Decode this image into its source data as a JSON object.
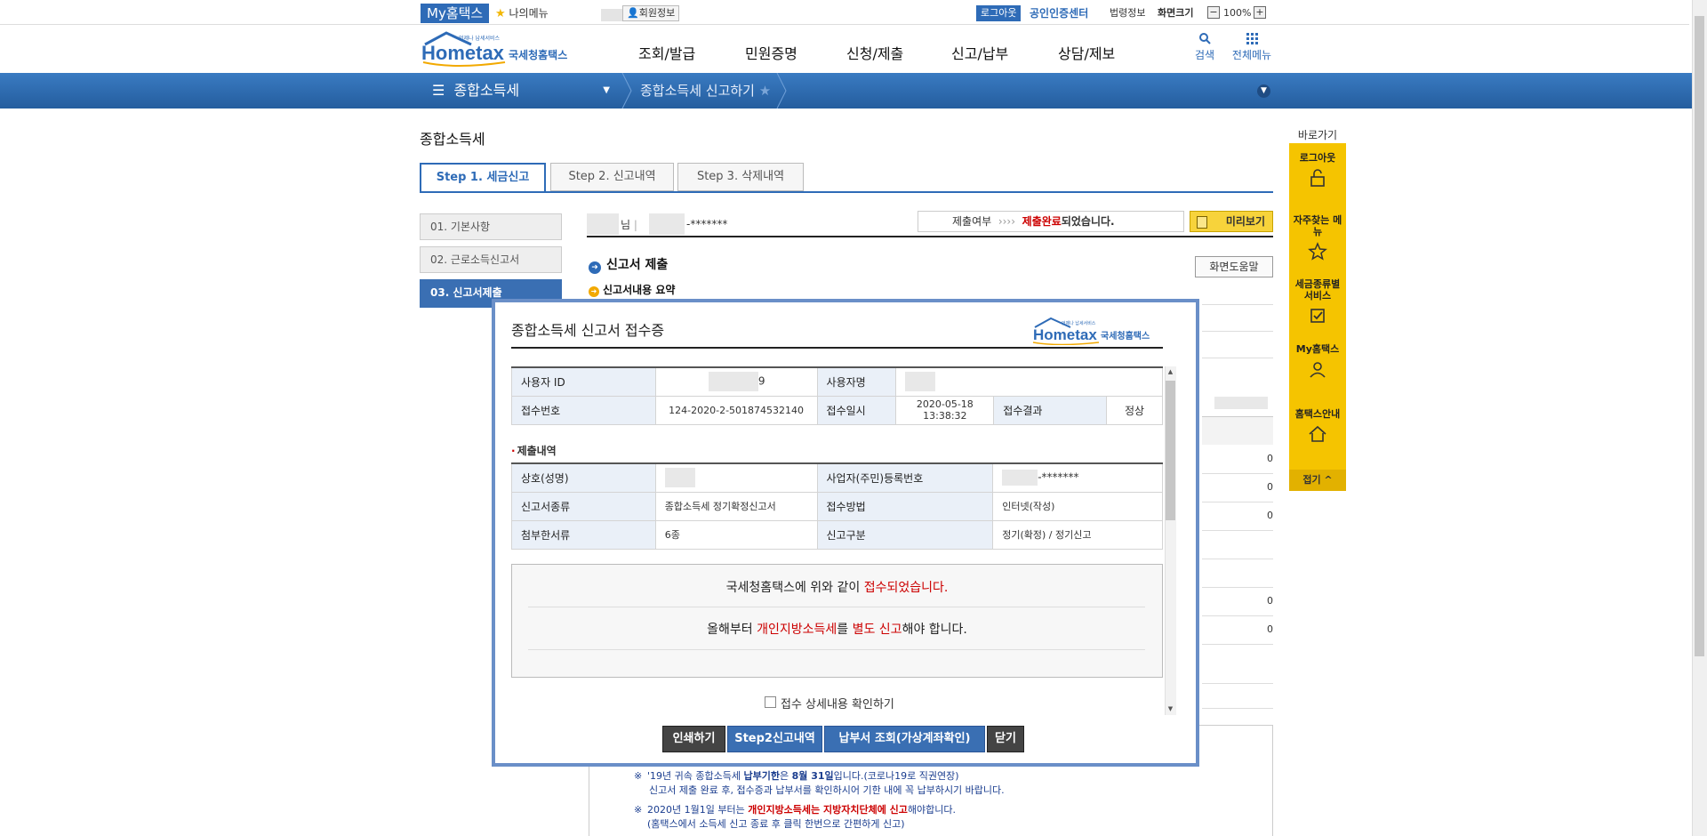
{
  "topbar": {
    "my_hometax": "My홈택스",
    "my_menu": "나의메뉴",
    "member_info": "회원정보",
    "logout": "로그아웃",
    "cert_center": "공인인증센터",
    "law_info": "법령정보",
    "screen_size": "화면크기",
    "zoom_minus": "−",
    "zoom_level": "100%",
    "zoom_plus": "+"
  },
  "header": {
    "logo_text": "Hometax",
    "logo_subtext": "국세청홈택스",
    "logo_tagline": "언제나 납세서비스",
    "nav": [
      "조회/발급",
      "민원증명",
      "신청/제출",
      "신고/납부",
      "상담/제보"
    ],
    "search": "검색",
    "all_menu": "전체메뉴"
  },
  "breadcrumb": {
    "section": "종합소득세",
    "current": "종합소득세 신고하기"
  },
  "page": {
    "title": "종합소득세",
    "tabs": [
      "Step 1. 세금신고",
      "Step 2. 신고내역",
      "Step 3. 삭제내역"
    ],
    "side_steps": [
      "01. 기본사항",
      "02. 근로소득신고서",
      "03. 신고서제출"
    ],
    "user_suffix": "님",
    "user_id_mask": "-*******",
    "submit_status_label": "제출여부",
    "submit_status_arrows": "››››",
    "submit_status_value": "제출완료",
    "submit_status_tail": "되었습니다.",
    "preview_button": "미리보기",
    "section_title": "신고서 제출",
    "help_button": "화면도움말",
    "summary_title": "신고서내용 요약",
    "bg_values": [
      "0",
      "0",
      "0",
      "0",
      "0"
    ]
  },
  "notices": {
    "line1_a": "'19년 귀속 종합소득세 ",
    "line1_b": "납부기한",
    "line1_c": "은 ",
    "line1_d": "8월 31일",
    "line1_e": "입니다.(코로나19로 직권연장)",
    "line2": "신고서 제출 완료 후, 접수증과 납부서를 확인하시어 기한 내에 꼭 납부하시기 바랍니다.",
    "line3_a": "2020년 1월1일 부터는 ",
    "line3_b": "개인지방소득세는 지방자치단체에 신고",
    "line3_c": "해야합니다.",
    "line4": "(홈택스에서 소득세 신고 종료 후 클릭 한번으로 간편하게 신고)",
    "mark": "※"
  },
  "quick_menu": {
    "title": "바로가기",
    "items": [
      "로그아웃",
      "자주찾는 메뉴",
      "세금종류별 서비스",
      "My홈택스",
      "홈택스안내"
    ],
    "fold": "접기 ^"
  },
  "modal": {
    "title": "종합소득세 신고서 접수증",
    "info": {
      "user_id_label": "사용자 ID",
      "user_id_tail": "9",
      "user_name_label": "사용자명",
      "receipt_no_label": "접수번호",
      "receipt_no": "124-2020-2-501874532140",
      "receipt_dt_label": "접수일시",
      "receipt_dt": "2020-05-18 13:38:32",
      "result_label": "접수결과",
      "result": "정상"
    },
    "detail_heading": "제출내역",
    "detail": {
      "company_label": "상호(성명)",
      "regno_label": "사업자(주민)등록번호",
      "regno_mask": "-*******",
      "type_label": "신고서종류",
      "type": "종합소득세 정기확정신고서",
      "method_label": "접수방법",
      "method": "인터넷(작성)",
      "docs_label": "첨부한서류",
      "docs": "6종",
      "category_label": "신고구분",
      "category": "정기(확정) / 정기신고"
    },
    "result_msg1_a": "국세청홈택스에 위와 같이 ",
    "result_msg1_b": "접수되었습니다.",
    "result_msg2_a": "올해부터 ",
    "result_msg2_b": "개인지방소득세",
    "result_msg2_c": "를 ",
    "result_msg2_d": "별도 신고",
    "result_msg2_e": "해야 합니다.",
    "confirm_label": "접수 상세내용 확인하기",
    "buttons": {
      "print": "인쇄하기",
      "step2": "Step2신고내역",
      "bill": "납부서 조회(가상계좌확인)",
      "close": "닫기"
    }
  },
  "colors": {
    "brand_blue": "#2e6bb7",
    "quick_yellow": "#f5c400",
    "alert_red": "#cc0000"
  }
}
